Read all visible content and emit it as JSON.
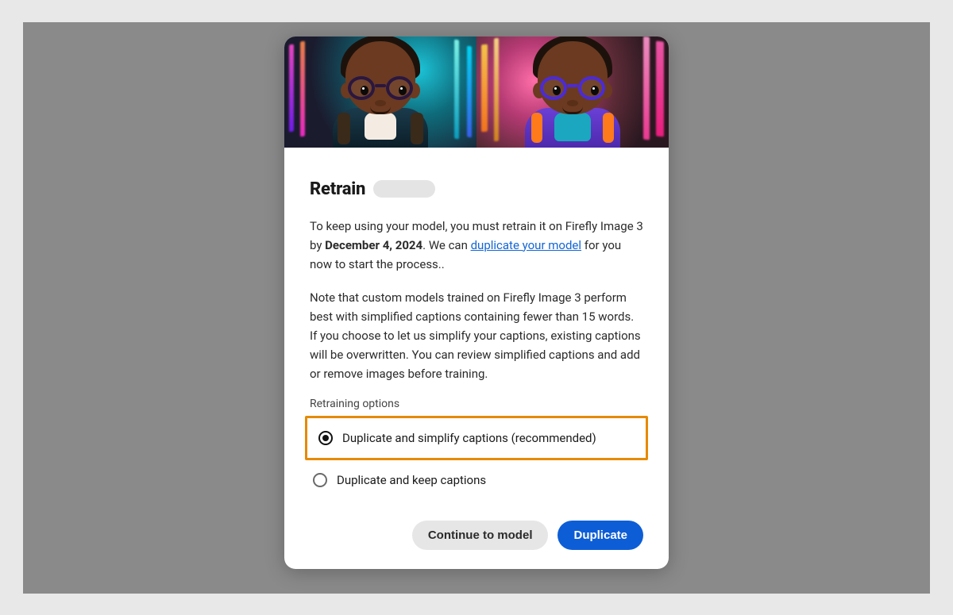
{
  "dialog": {
    "title": "Retrain",
    "body_intro_1": "To keep using your model, you must retrain it on Firefly Image 3 by ",
    "deadline": "December 4, 2024",
    "body_intro_2": ". We can ",
    "duplicate_link": "duplicate your model",
    "body_intro_3": " for you now to start the process..",
    "body_note": "Note that custom models trained on Firefly Image 3 perform best with simplified captions containing fewer than 15 words. If you choose to let us simplify your captions, existing captions will be overwritten. You can review simplified captions and add or remove images before training.",
    "options_label": "Retraining options",
    "options": [
      {
        "label": "Duplicate and simplify captions (recommended)",
        "selected": true,
        "highlighted": true
      },
      {
        "label": "Duplicate and keep captions",
        "selected": false,
        "highlighted": false
      }
    ],
    "actions": {
      "secondary": "Continue to model",
      "primary": "Duplicate"
    }
  }
}
